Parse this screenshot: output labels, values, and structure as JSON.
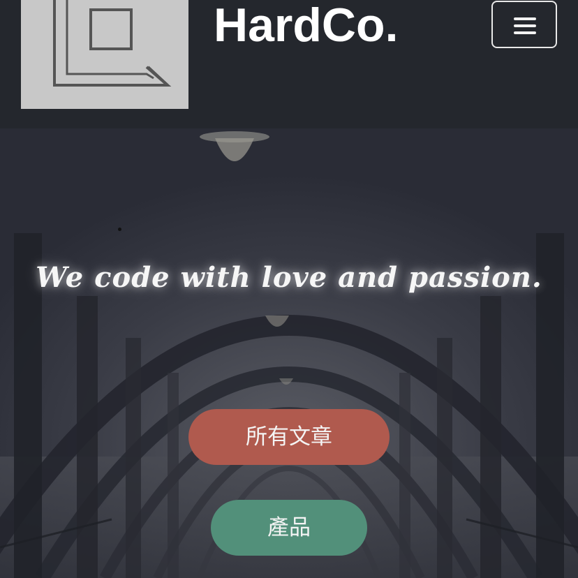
{
  "header": {
    "brand": "HardCo.",
    "menu_icon": "hamburger-menu-icon",
    "logo_icon": "nested-squares-logo-icon"
  },
  "hero": {
    "tagline": "We code with love and passion.",
    "background": "foggy-bridge-tunnel-photo"
  },
  "buttons": {
    "articles_label": "所有文章",
    "products_label": "產品"
  },
  "colors": {
    "header_bg": "#24272d",
    "articles_button": "#b05a4e",
    "products_button": "#52907a"
  }
}
